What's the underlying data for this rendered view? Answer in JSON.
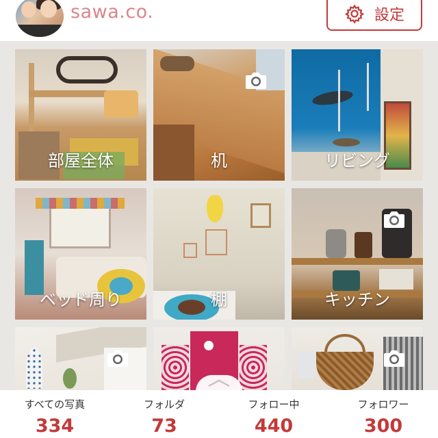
{
  "profile": {
    "username": "sawa.co.",
    "settings_label": "設定"
  },
  "tiles": [
    {
      "caption": "部屋全体",
      "camera": false
    },
    {
      "caption": "机",
      "camera": true
    },
    {
      "caption": "リビング",
      "camera": false
    },
    {
      "caption": "ベッド周り",
      "camera": false
    },
    {
      "caption": "棚",
      "camera": false
    },
    {
      "caption": "キッチン",
      "camera": true
    },
    {
      "caption": "",
      "camera": true
    },
    {
      "caption": "",
      "camera": false
    },
    {
      "caption": "",
      "camera": true
    }
  ],
  "stats": [
    {
      "label": "すべての写真",
      "value": "334"
    },
    {
      "label": "フォルダ",
      "value": "73"
    },
    {
      "label": "フォロー中",
      "value": "440"
    },
    {
      "label": "フォロワー",
      "value": "300"
    }
  ],
  "colors": {
    "accent": "#c33a3a",
    "username": "#d9868b"
  }
}
